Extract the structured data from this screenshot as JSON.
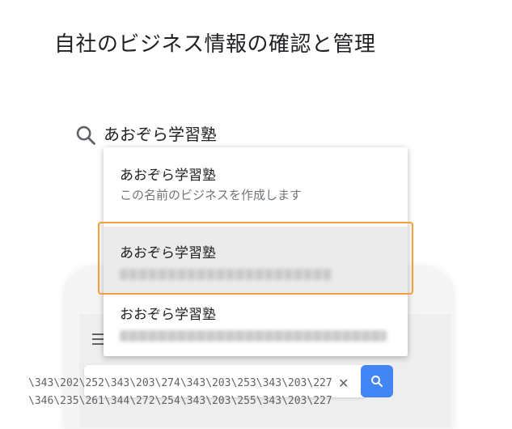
{
  "page": {
    "title": "自社のビジネス情報の確認と管理"
  },
  "search": {
    "value": "あおぞら学習塾"
  },
  "suggestions": [
    {
      "name": "あおぞら学習塾",
      "description": "この名前のビジネスを作成します"
    },
    {
      "name": "あおぞら学習塾",
      "description_blurred": true
    },
    {
      "name": "おおぞら学習塾",
      "description_blurred": true
    }
  ],
  "highlight": {
    "color": "#f4a03a"
  },
  "phone": {
    "search_text_line1": "\\343\\202\\252\\343\\203\\274\\343\\203\\253\\343\\203\\227",
    "search_text_line2": "\\346\\235\\261\\344\\272\\254\\343\\203\\255\\343\\203\\227",
    "accent": "#4285f4"
  }
}
